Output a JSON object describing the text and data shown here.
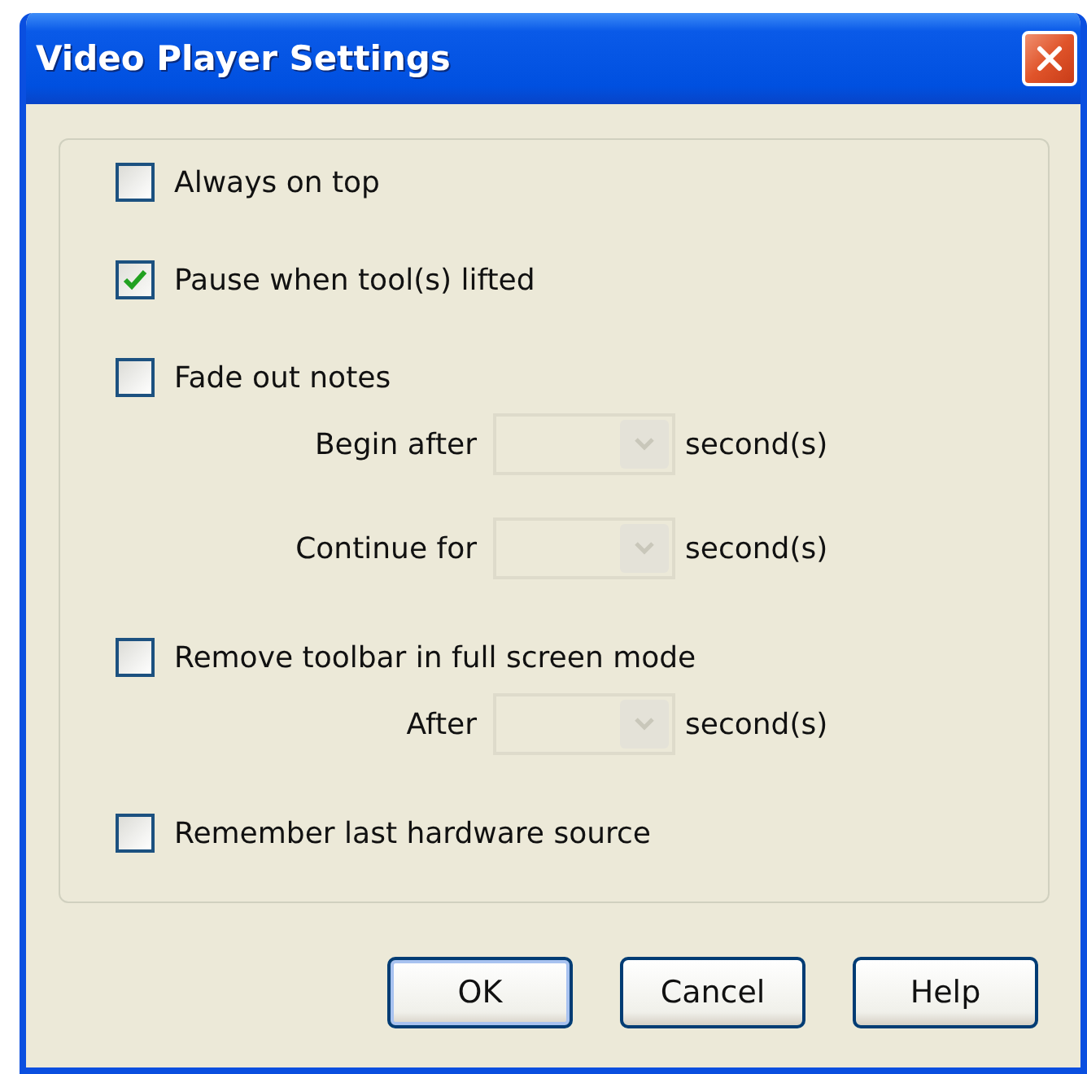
{
  "window": {
    "title": "Video Player Settings"
  },
  "options": [
    {
      "label": "Always on top",
      "checked": false
    },
    {
      "label": "Pause when tool(s) lifted",
      "checked": true
    },
    {
      "label": "Fade out notes",
      "checked": false,
      "sub_settings": [
        {
          "label": "Begin after",
          "unit": "second(s)",
          "disabled": true
        },
        {
          "label": "Continue for",
          "unit": "second(s)",
          "disabled": true
        }
      ]
    },
    {
      "label": "Remove toolbar in full screen mode",
      "checked": false,
      "sub_settings": [
        {
          "label": "After",
          "unit": "second(s)",
          "disabled": true
        }
      ]
    },
    {
      "label": "Remember last hardware source",
      "checked": false
    }
  ],
  "buttons": [
    {
      "label": "OK",
      "default": true
    },
    {
      "label": "Cancel",
      "default": false
    },
    {
      "label": "Help",
      "default": false
    }
  ]
}
